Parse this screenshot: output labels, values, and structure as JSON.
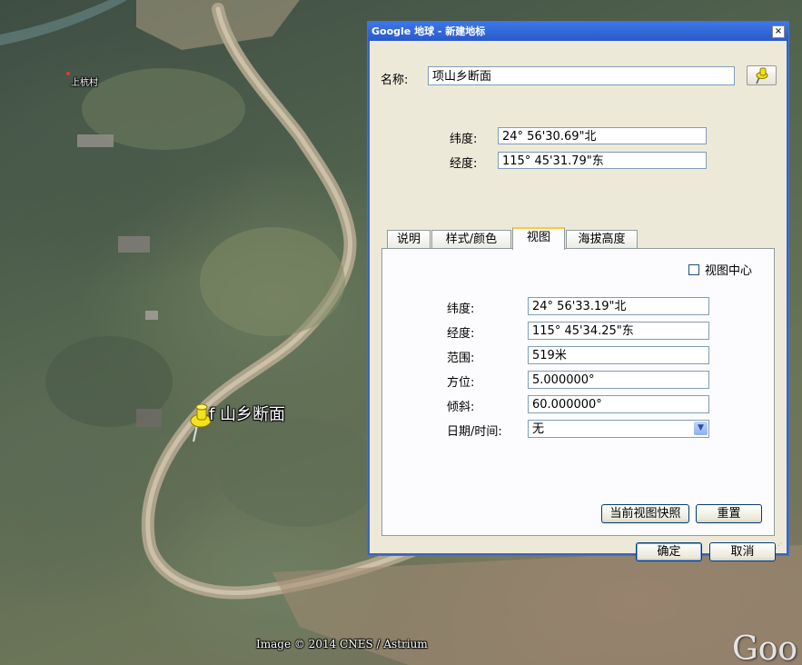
{
  "map": {
    "village_label": "上杭村",
    "placemark_label": "f 山乡断面",
    "copyright": "Image © 2014 CNES / Astrium",
    "logo": "Goo"
  },
  "dialog": {
    "title": "Google 地球 - 新建地标",
    "close_glyph": "×",
    "name_label": "名称:",
    "name_value": "项山乡断面",
    "lat_label": "纬度:",
    "lat_value": "  24° 56'30.69\"北",
    "lon_label": "经度:",
    "lon_value": "115° 45'31.79\"东",
    "tabs": [
      {
        "label": "说明",
        "active": false
      },
      {
        "label": "样式/颜色",
        "active": false
      },
      {
        "label": "视图",
        "active": true
      },
      {
        "label": "海拔高度",
        "active": false
      }
    ],
    "view": {
      "view_center_label": "视图中心",
      "view_center_checked": false,
      "lat_label": "纬度:",
      "lat_value": "  24° 56'33.19\"北",
      "lon_label": "经度:",
      "lon_value": "115° 45'34.25\"东",
      "range_label": "范围:",
      "range_value": "519米",
      "heading_label": "方位:",
      "heading_value": "5.000000°",
      "tilt_label": "倾斜:",
      "tilt_value": "60.000000°",
      "datetime_label": "日期/时间:",
      "datetime_value": "无",
      "snapshot_button": "当前视图快照",
      "reset_button": "重置"
    },
    "ok_button": "确定",
    "cancel_button": "取消"
  },
  "colors": {
    "titlebar": "#2a5ac9",
    "dialog_bg": "#ece9d8",
    "active_tab_accent": "#ffc83c",
    "pin": "#f3e21c"
  },
  "icons": [
    "pushpin-icon",
    "close-icon",
    "dropdown-arrow-icon",
    "checkbox-icon",
    "resize-grip-icon"
  ]
}
